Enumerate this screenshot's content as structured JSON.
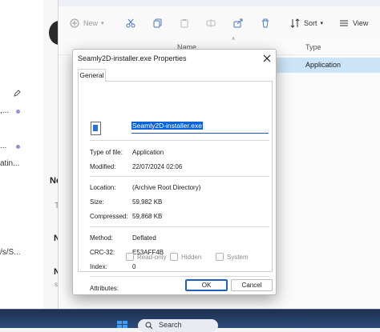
{
  "background": {
    "left_fragments": [
      ",...",
      "...",
      "atin...",
      "/s/S..."
    ],
    "left_bold": [
      "Ne",
      "N",
      "N"
    ],
    "left_small": [
      "T",
      "s"
    ]
  },
  "explorer": {
    "toolbar": {
      "new_label": "New",
      "sort_label": "Sort",
      "view_label": "View"
    },
    "columns": {
      "name": "Name",
      "type": "Type"
    },
    "selected_row_type": "Application"
  },
  "taskbar": {
    "search_label": "Search"
  },
  "dialog": {
    "title": "Seamly2D-installer.exe Properties",
    "tab_label": "General",
    "filename": "Seamly2D-installer.exe",
    "properties": [
      {
        "label": "Type of file:",
        "value": "Application"
      },
      {
        "label": "Modified:",
        "value": "22/07/2024 02:06"
      },
      {
        "label": "Location:",
        "value": "(Archive Root Directory)"
      },
      {
        "label": "Size:",
        "value": "59,982 KB"
      },
      {
        "label": "Compressed:",
        "value": "59,868 KB"
      },
      {
        "label": "Method:",
        "value": "Deflated"
      },
      {
        "label": "CRC-32:",
        "value": "E53AFF4B"
      },
      {
        "label": "Index:",
        "value": "0"
      }
    ],
    "attributes": {
      "label": "Attributes:",
      "options": [
        {
          "label": "Read-only",
          "checked": false
        },
        {
          "label": "Hidden",
          "checked": false
        },
        {
          "label": "System",
          "checked": false
        }
      ]
    },
    "ok_label": "OK",
    "cancel_label": "Cancel"
  },
  "colors": {
    "accent": "#0a64d8",
    "selection": "#cce4f7",
    "taskbar": "#22385d"
  }
}
